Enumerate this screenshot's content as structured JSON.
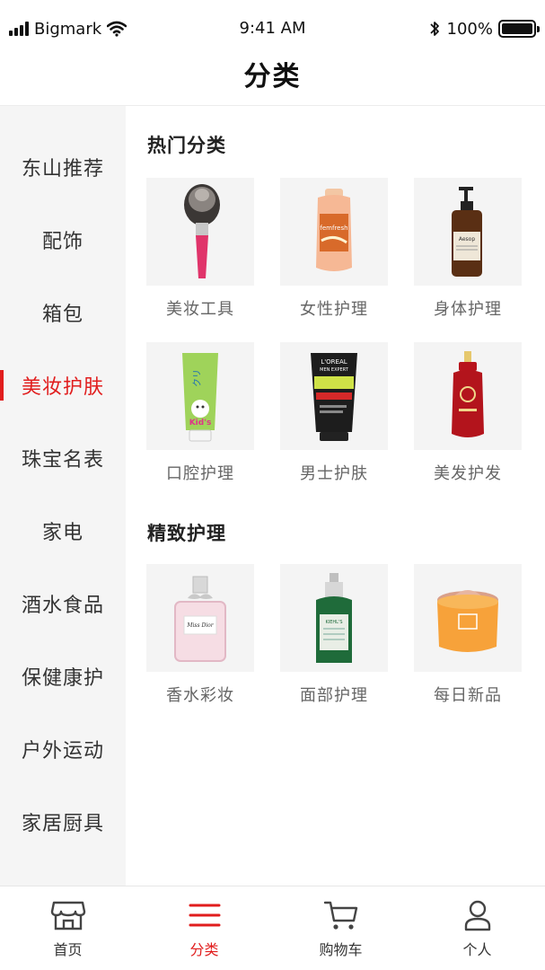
{
  "status_bar": {
    "carrier": "Bigmark",
    "time": "9:41 AM",
    "battery": "100%",
    "battery_level": 1.0
  },
  "header": {
    "title": "分类"
  },
  "sidebar": {
    "items": [
      {
        "label": "东山推荐",
        "active": false
      },
      {
        "label": "配饰",
        "active": false
      },
      {
        "label": "箱包",
        "active": false
      },
      {
        "label": "美妆护肤",
        "active": true
      },
      {
        "label": "珠宝名表",
        "active": false
      },
      {
        "label": "家电",
        "active": false
      },
      {
        "label": "酒水食品",
        "active": false
      },
      {
        "label": "保健康护",
        "active": false
      },
      {
        "label": "户外运动",
        "active": false
      },
      {
        "label": "家居厨具",
        "active": false
      }
    ]
  },
  "sections": [
    {
      "title": "热门分类",
      "items": [
        {
          "label": "美妆工具",
          "image": "makeup-brush"
        },
        {
          "label": "女性护理",
          "image": "wash-bottle"
        },
        {
          "label": "身体护理",
          "image": "amber-pump-bottle"
        },
        {
          "label": "口腔护理",
          "image": "toothpaste-tube"
        },
        {
          "label": "男士护肤",
          "image": "mens-cleanser-tube"
        },
        {
          "label": "美发护发",
          "image": "shampoo-bottle"
        }
      ]
    },
    {
      "title": "精致护理",
      "items": [
        {
          "label": "香水彩妆",
          "image": "perfume-bottle"
        },
        {
          "label": "面部护理",
          "image": "serum-bottle"
        },
        {
          "label": "每日新品",
          "image": "cream-jar"
        }
      ]
    }
  ],
  "product_text": {
    "brand_fem": "femfresh",
    "brand_aesop": "Aesop",
    "brand_kids": "Kid's",
    "brand_loreal": "L'OREAL",
    "brand_loreal_sub": "MEN EXPERT",
    "brand_dior": "Miss Dior",
    "brand_kiehls": "KIEHL'S"
  },
  "tab_bar": {
    "tabs": [
      {
        "label": "首页",
        "icon": "store-icon",
        "active": false
      },
      {
        "label": "分类",
        "icon": "menu-icon",
        "active": true
      },
      {
        "label": "购物车",
        "icon": "cart-icon",
        "active": false
      },
      {
        "label": "个人",
        "icon": "person-icon",
        "active": false
      }
    ]
  },
  "colors": {
    "accent": "#e11d1d",
    "sidebar_bg": "#f5f5f5",
    "thumb_bg": "#f4f4f4"
  }
}
